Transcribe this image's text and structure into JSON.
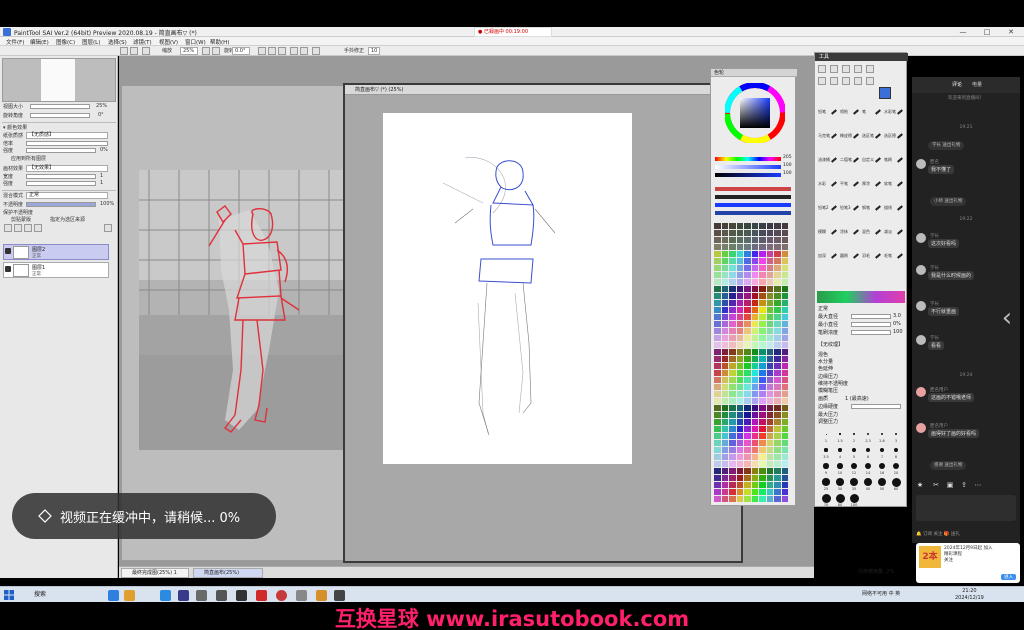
{
  "window": {
    "title": "PaintTool SAI Ver.2 (64bit) Preview 2020.08.19 - 简直画布▽ (*)",
    "recording_badge": "● 已録画中 00:19:00",
    "minimize": "—",
    "maximize": "□",
    "close": "✕"
  },
  "menu": [
    "文件(F)",
    "编辑(E)",
    "图像(C)",
    "图层(L)",
    "选择(S)",
    "滤镜(T)",
    "视图(V)",
    "窗口(W)",
    "帮助(H)"
  ],
  "toolbar": {
    "zoom_label": "缩放",
    "zoom_value": "25%",
    "rotate_label": "旋转",
    "rotate_value": "0.0°",
    "stabilizer_label": "手抖修正",
    "stabilizer_value": "10"
  },
  "left_panel": {
    "zoom_row_label": "视图大小",
    "zoom_row_value": "25%",
    "angle_row_label": "旋转角度",
    "angle_row_value": "0°",
    "section_title": "▾ 颜色效果",
    "texture_label": "纸张质感",
    "texture_value": "【无质感】",
    "scale_label": "倍率",
    "strength_label": "强度",
    "strength_value": "0%",
    "checkbox_label": "应用到所有图层",
    "effect_label": "画材效果",
    "effect_value": "【无效果】",
    "width_label": "宽度",
    "width_value": "1",
    "intensity_label": "强度",
    "intensity_value": "1",
    "blend_label": "混合模式",
    "blend_value": "正常",
    "opacity_label": "不透明度",
    "opacity_value": "100%",
    "protect_label": "保护不透明度",
    "clip_label": "剪贴蒙版",
    "sel_src_label": "指定为选区来源",
    "layers": [
      {
        "name": "图层2",
        "mode": "正常",
        "opacity": "100%"
      },
      {
        "name": "图层1",
        "mode": "正常",
        "opacity": "100%"
      }
    ]
  },
  "canvas": {
    "title": "简直画布▽ (*) (25%)"
  },
  "buffer_toast": {
    "icon": "diamond-badge-icon",
    "text": "视频正在缓冲中，请稍候... 0%"
  },
  "color_panel": {
    "title": "色轮",
    "slider_labels": [
      "H",
      "S",
      "V"
    ],
    "slider_values": [
      "205",
      "100",
      "100"
    ]
  },
  "tool_panel": {
    "title": "工具",
    "tools": [
      "铅笔",
      "喷枪",
      "笔",
      "水彩笔",
      "马克笔",
      "橡皮擦",
      "选区笔",
      "选区擦",
      "油漆桶",
      "二值笔",
      "自定义",
      "笔刷",
      "水彩",
      "平笔",
      "厚涂",
      "软笔",
      "铅笔2",
      "铅笔3",
      "钢笔",
      "描线",
      "模糊",
      "涂抹",
      "混色",
      "减淡",
      "加深",
      "圆刷",
      "羽毛",
      "毛笔"
    ],
    "mode_label": "正常",
    "size_label": "最大直径",
    "size_value": "3.0",
    "min_size_label": "最小直径",
    "min_size_value": "0%",
    "density_label": "笔刷浓度",
    "density_value": "100",
    "texture_label": "【无纹理】",
    "blend_label": "混色",
    "dilution_label": "水分量",
    "persist_label": "色延伸",
    "brush_options": [
      "边缘压力",
      "维持不透明度",
      "模糊笔压"
    ],
    "quality_label": "画质",
    "quality_value": "1 (最高速)",
    "edge_label": "边缘硬度",
    "pressure_labels": [
      "最大压力",
      "调整压力"
    ],
    "dot_sizes": [
      "1",
      "1.5",
      "2",
      "2.3",
      "2.6",
      "3",
      "3.5",
      "4",
      "5",
      "6",
      "7",
      "8",
      "9",
      "10",
      "12",
      "14",
      "16",
      "20",
      "25",
      "30",
      "35",
      "40",
      "50",
      "60",
      "70",
      "80",
      "100"
    ]
  },
  "chat": {
    "tabs": [
      "评论",
      "电量"
    ],
    "notice": "欢迎来到直播间！",
    "messages": [
      {
        "name": "匿名",
        "text": "我不懂了"
      },
      {
        "name": "学长",
        "text": "这次好看吗"
      },
      {
        "name": "学长",
        "text": "我是什么时候画的"
      },
      {
        "name": "学长",
        "text": "不行就重画"
      },
      {
        "name": "学长",
        "text": "看看"
      },
      {
        "name": "匿名用户",
        "text": "这画的不错哦老师"
      },
      {
        "name": "匿名用户",
        "text": "画得好了画的好看吗"
      }
    ],
    "system_lines": [
      "19:21",
      "19:22",
      "19:24"
    ],
    "pills": [
      "学长 送出礼物",
      "小师 送出礼物",
      "感谢 送出礼物"
    ],
    "toolbar_icons": [
      "star-icon",
      "scissors-icon",
      "screenshot-icon",
      "share-icon",
      "more-icon"
    ],
    "footer": "🔔 订阅 关注    🎁 送礼"
  },
  "promo": {
    "logo": "2本",
    "line1": "2024年12月9日起 加入",
    "line2": "精彩课程",
    "line3": "关注",
    "button": "进入"
  },
  "doc_tabs": [
    "最终完成图(25%) 1",
    "简直画布(25%)"
  ],
  "status": {
    "memory": "内存使用量: 2%"
  },
  "taskbar": {
    "search": "搜索",
    "tray_text": "网络不可用 中 英",
    "time": "21:20",
    "date": "2024/12/19"
  },
  "watermark": "互换星球 www.irasutobook.com",
  "colors": {
    "accent": "#3a6fd8",
    "watermark": "#ff1f6a",
    "sketch_red": "#e0303a",
    "sketch_blue": "#3a4fd0"
  }
}
